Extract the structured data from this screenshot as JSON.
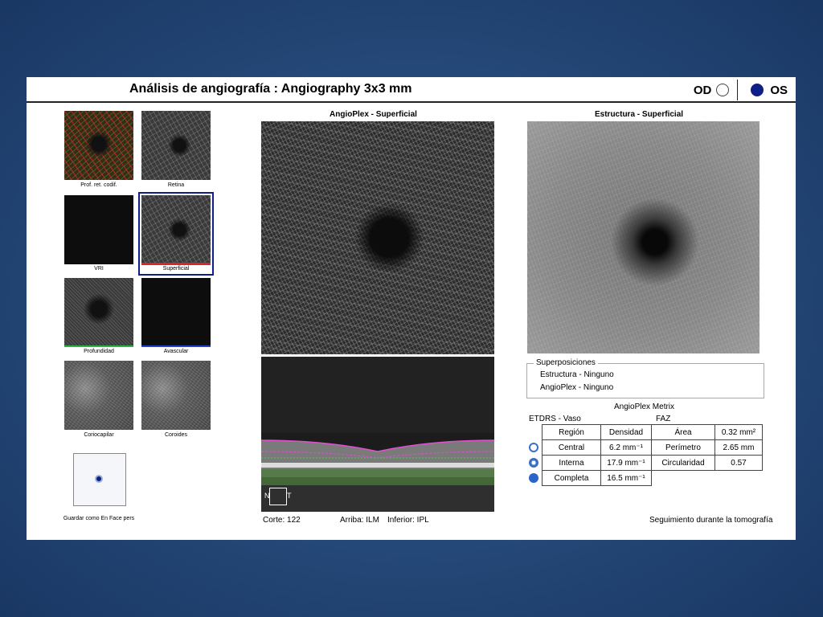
{
  "header": {
    "title": "Análisis de angiografía : Angiography 3x3 mm",
    "eye_od": "OD",
    "eye_os": "OS",
    "selected_eye": "OS"
  },
  "thumbnails": [
    {
      "label": "Prof. ret. codif."
    },
    {
      "label": "Retina"
    },
    {
      "label": "VRI"
    },
    {
      "label": "Superficial"
    },
    {
      "label": "Profundidad"
    },
    {
      "label": "Avascular"
    },
    {
      "label": "Coriocapilar"
    },
    {
      "label": "Coroides"
    }
  ],
  "save_enface": {
    "label": "Guardar como En Face pers"
  },
  "angio_panel": {
    "title": "AngioPlex - Superficial"
  },
  "structure_panel": {
    "title": "Estructura - Superficial"
  },
  "bscan": {
    "nasal": "N",
    "temporal": "T",
    "slice": "Corte: 122",
    "upper": "Arriba: ILM",
    "lower": "Inferior: IPL"
  },
  "overlays": {
    "title": "Superposiciones",
    "items": [
      "Estructura - Ninguno",
      "AngioPlex - Ninguno"
    ]
  },
  "metrix": {
    "title": "AngioPlex Metrix",
    "etdrs_label": "ETDRS - Vaso",
    "faz_label": "FAZ",
    "etdrs_headers": [
      "Región",
      "Densidad"
    ],
    "etdrs_rows": [
      {
        "region": "Central",
        "value": "6.2 mm⁻¹"
      },
      {
        "region": "Interna",
        "value": "17.9 mm⁻¹"
      },
      {
        "region": "Completa",
        "value": "16.5 mm⁻¹"
      }
    ],
    "faz_rows": [
      {
        "name": "Área",
        "value": "0.32 mm²"
      },
      {
        "name": "Perímetro",
        "value": "2.65 mm"
      },
      {
        "name": "Circularidad",
        "value": "0.57"
      }
    ]
  },
  "footer": {
    "tracking": "Seguimiento durante la tomografía"
  },
  "colors": {
    "accent_blue": "#0e1f85",
    "superficial_bar": "#d9262b",
    "profundidad_bar": "#2fb24a",
    "avascular_bar": "#2244cc",
    "background": "#244878"
  }
}
